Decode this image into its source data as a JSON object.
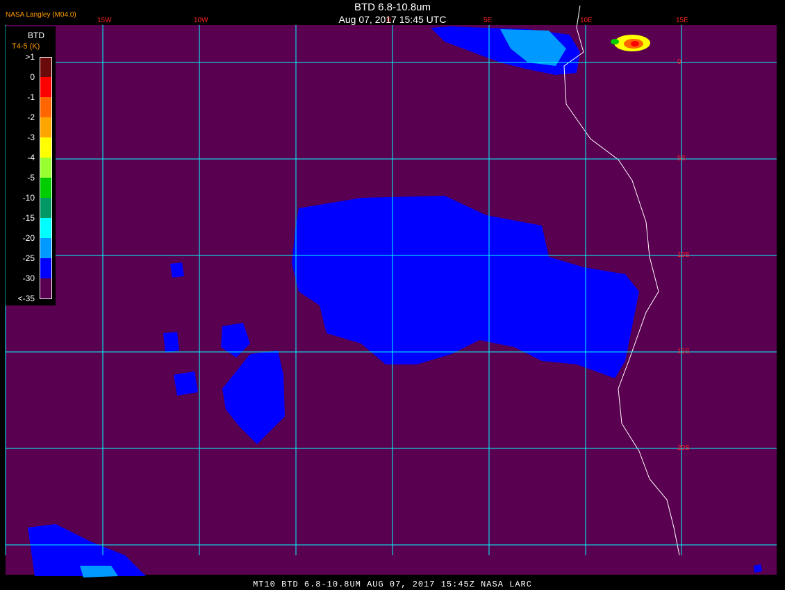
{
  "header": {
    "title": "BTD 6.8-10.8um",
    "date": "Aug 07, 2017 15:45 UTC",
    "provider": "NASA Langley (M04.0)"
  },
  "legend": {
    "title": "BTD",
    "subtitle": "T4-5 (K)",
    "entries": [
      {
        "label": ">1",
        "color": "#6b0a0a"
      },
      {
        "label": "0",
        "color": "#ff0000"
      },
      {
        "label": "-1",
        "color": "#ff6600"
      },
      {
        "label": "-2",
        "color": "#ffa500"
      },
      {
        "label": "-3",
        "color": "#ffff00"
      },
      {
        "label": "-4",
        "color": "#99ff33"
      },
      {
        "label": "-5",
        "color": "#00cc00"
      },
      {
        "label": "-10",
        "color": "#009966"
      },
      {
        "label": "-15",
        "color": "#00ffff"
      },
      {
        "label": "-20",
        "color": "#0099ff"
      },
      {
        "label": "-25",
        "color": "#0000ff"
      },
      {
        "label": "-30",
        "color": "#5a0050"
      },
      {
        "label": "<-35",
        "color": "#5a0050"
      }
    ]
  },
  "grid": {
    "longitudes": [
      "15W",
      "10W",
      "0",
      "5E",
      "10E",
      "15E"
    ],
    "latitudes": [
      "0",
      "5S",
      "10S",
      "15S",
      "20S"
    ],
    "color": "#00ffff"
  },
  "colors": {
    "background": "#5a0050",
    "cloud": "#0000ff",
    "coastline": "#ffffff",
    "label": "#ff2222"
  },
  "footer": {
    "caption": "MT10  BTD 6.8-10.8UM   AUG 07, 2017 15:45Z   NASA LARC"
  }
}
